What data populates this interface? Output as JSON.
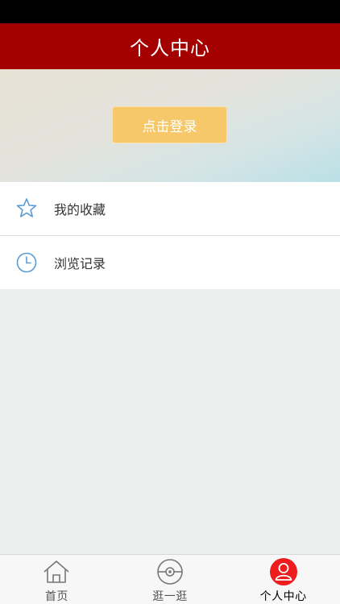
{
  "nav": {
    "title": "个人中心"
  },
  "banner": {
    "login_label": "点击登录"
  },
  "menu": {
    "items": [
      {
        "label": "我的收藏",
        "icon": "star-icon"
      },
      {
        "label": "浏览记录",
        "icon": "clock-icon"
      }
    ]
  },
  "tabbar": {
    "tabs": [
      {
        "label": "首页",
        "icon": "home-icon",
        "active": false
      },
      {
        "label": "逛一逛",
        "icon": "pokeball-icon",
        "active": false
      },
      {
        "label": "个人中心",
        "icon": "user-icon",
        "active": true
      }
    ]
  },
  "colors": {
    "nav_background": "#a50000",
    "login_button": "#f7c86a",
    "menu_icon": "#5b9bd5",
    "tab_active": "#ee1c1c",
    "page_background": "#ecefee"
  }
}
